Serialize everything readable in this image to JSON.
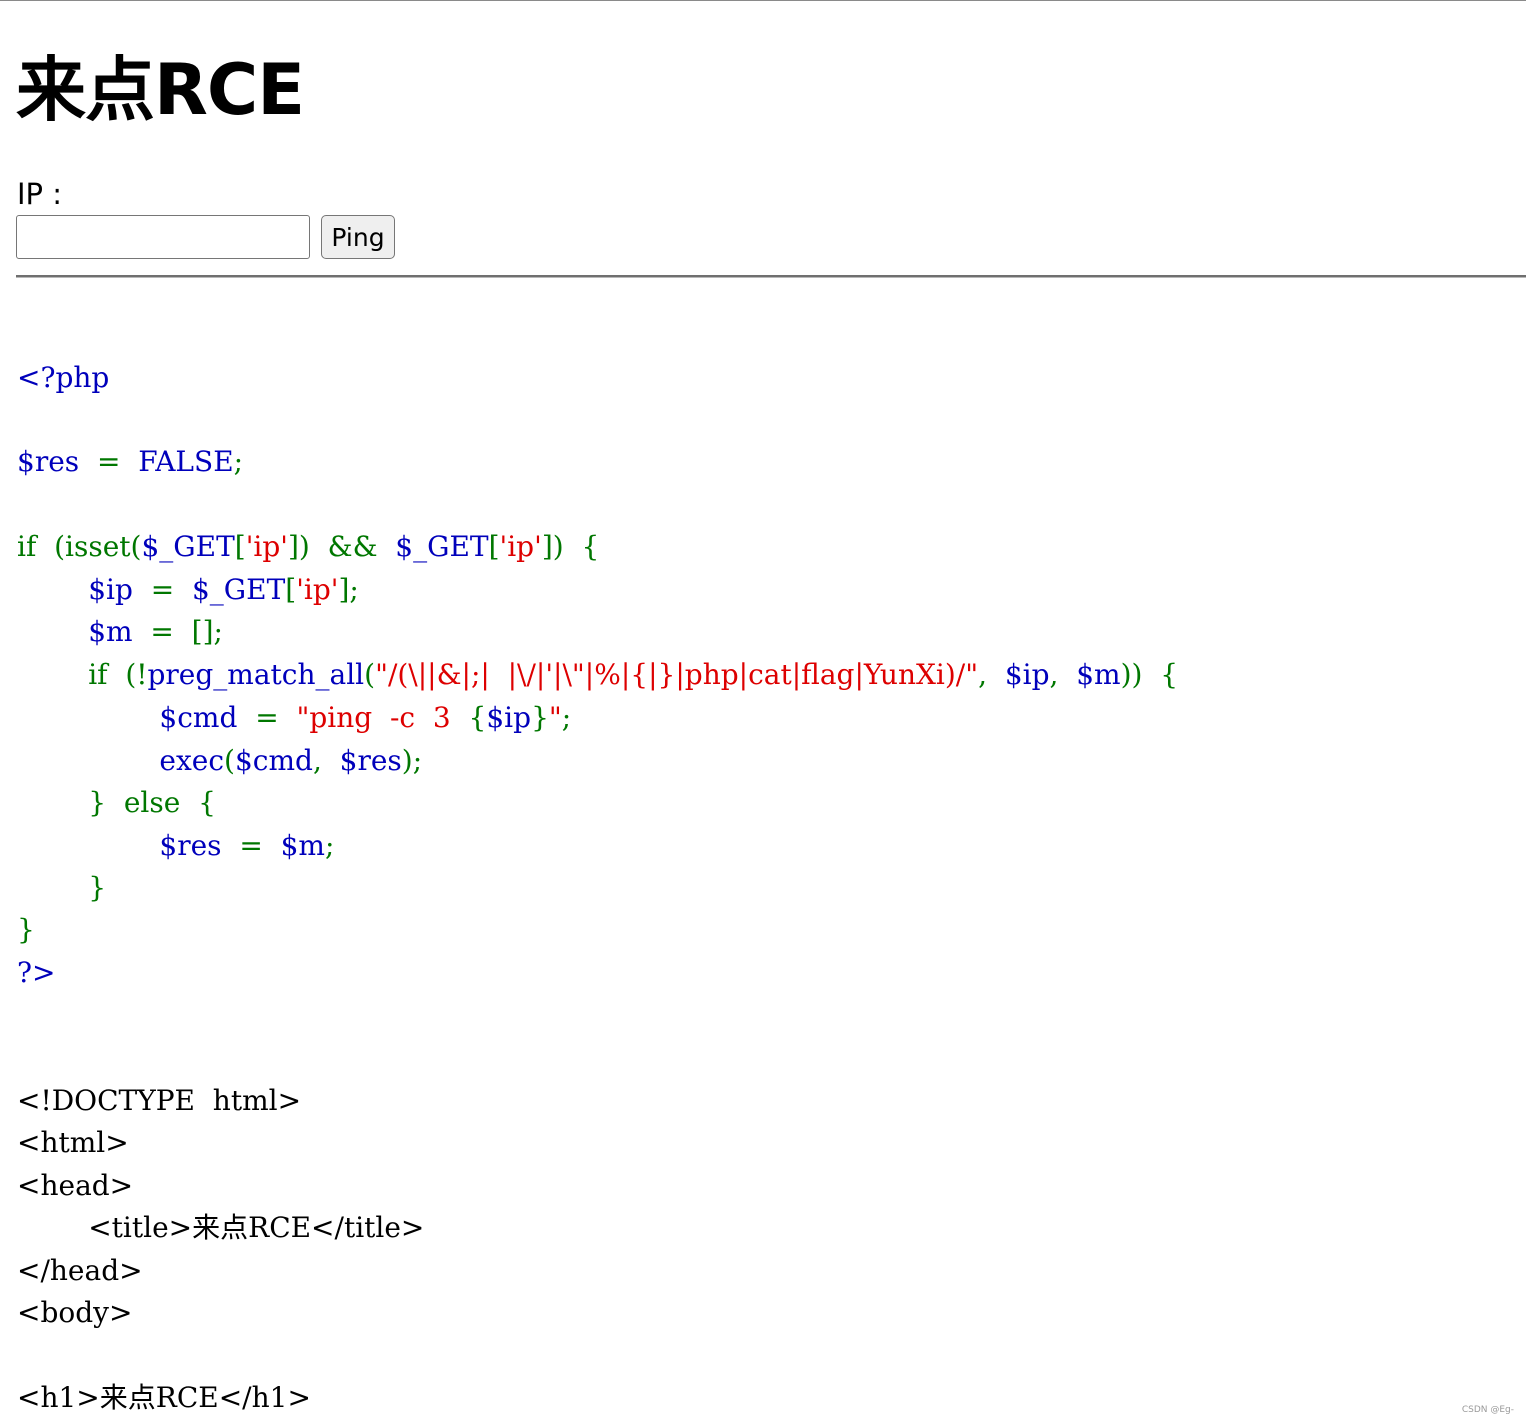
{
  "page": {
    "title": "来点RCE",
    "ip_label": "IP :",
    "ip_value": "",
    "ping_label": "Ping"
  },
  "colors": {
    "keyword": "#007700",
    "variable": "#0000bb",
    "string": "#dd0000",
    "text": "#000000"
  },
  "code_lines": [
    [
      {
        "t": "<?php",
        "c": "var"
      }
    ],
    [
      {
        "t": "$res",
        "c": "var"
      },
      {
        "t": "  =  ",
        "c": "kw"
      },
      {
        "t": "FALSE",
        "c": "var"
      },
      {
        "t": ";",
        "c": "kw"
      }
    ],
    [
      {
        "t": "if  (isset(",
        "c": "kw"
      },
      {
        "t": "$_GET",
        "c": "var"
      },
      {
        "t": "[",
        "c": "kw"
      },
      {
        "t": "'ip'",
        "c": "str"
      },
      {
        "t": "])  &&  ",
        "c": "kw"
      },
      {
        "t": "$_GET",
        "c": "var"
      },
      {
        "t": "[",
        "c": "kw"
      },
      {
        "t": "'ip'",
        "c": "str"
      },
      {
        "t": "])  {",
        "c": "kw"
      }
    ],
    [
      {
        "t": "        ",
        "c": "kw"
      },
      {
        "t": "$ip",
        "c": "var"
      },
      {
        "t": "  =  ",
        "c": "kw"
      },
      {
        "t": "$_GET",
        "c": "var"
      },
      {
        "t": "[",
        "c": "kw"
      },
      {
        "t": "'ip'",
        "c": "str"
      },
      {
        "t": "];",
        "c": "kw"
      }
    ],
    [
      {
        "t": "        ",
        "c": "kw"
      },
      {
        "t": "$m",
        "c": "var"
      },
      {
        "t": "  =  [];",
        "c": "kw"
      }
    ],
    [
      {
        "t": "        if  (!",
        "c": "kw"
      },
      {
        "t": "preg_match_all",
        "c": "var"
      },
      {
        "t": "(",
        "c": "kw"
      },
      {
        "t": "\"/(\\||&|;|  |\\/|'|\\\"|%|{|}|php|cat|flag|YunXi)/\"",
        "c": "str"
      },
      {
        "t": ",  ",
        "c": "kw"
      },
      {
        "t": "$ip",
        "c": "var"
      },
      {
        "t": ",  ",
        "c": "kw"
      },
      {
        "t": "$m",
        "c": "var"
      },
      {
        "t": "))  {",
        "c": "kw"
      }
    ],
    [
      {
        "t": "                ",
        "c": "kw"
      },
      {
        "t": "$cmd",
        "c": "var"
      },
      {
        "t": "  =  ",
        "c": "kw"
      },
      {
        "t": "\"ping  -c  3  ",
        "c": "str"
      },
      {
        "t": "{",
        "c": "kw"
      },
      {
        "t": "$ip",
        "c": "var"
      },
      {
        "t": "}",
        "c": "kw"
      },
      {
        "t": "\"",
        "c": "str"
      },
      {
        "t": ";",
        "c": "kw"
      }
    ],
    [
      {
        "t": "                ",
        "c": "kw"
      },
      {
        "t": "exec",
        "c": "var"
      },
      {
        "t": "(",
        "c": "kw"
      },
      {
        "t": "$cmd",
        "c": "var"
      },
      {
        "t": ",  ",
        "c": "kw"
      },
      {
        "t": "$res",
        "c": "var"
      },
      {
        "t": ");",
        "c": "kw"
      }
    ],
    [
      {
        "t": "        }  else  {",
        "c": "kw"
      }
    ],
    [
      {
        "t": "                ",
        "c": "kw"
      },
      {
        "t": "$res",
        "c": "var"
      },
      {
        "t": "  =  ",
        "c": "kw"
      },
      {
        "t": "$m",
        "c": "var"
      },
      {
        "t": ";",
        "c": "kw"
      }
    ],
    [
      {
        "t": "        }",
        "c": "kw"
      }
    ],
    [
      {
        "t": "}",
        "c": "kw"
      }
    ],
    [
      {
        "t": "?>",
        "c": "var"
      }
    ],
    [
      {
        "t": "<!DOCTYPE  html>",
        "c": "txt"
      }
    ],
    [
      {
        "t": "<html>",
        "c": "txt"
      }
    ],
    [
      {
        "t": "<head>",
        "c": "txt"
      }
    ],
    [
      {
        "t": "        <title>来点RCE</title>",
        "c": "txt"
      }
    ],
    [
      {
        "t": "</head>",
        "c": "txt"
      }
    ],
    [
      {
        "t": "<body>",
        "c": "txt"
      }
    ],
    [
      {
        "t": "<h1>来点RCE</h1>",
        "c": "txt"
      }
    ]
  ],
  "watermark": "CSDN @Eg-"
}
